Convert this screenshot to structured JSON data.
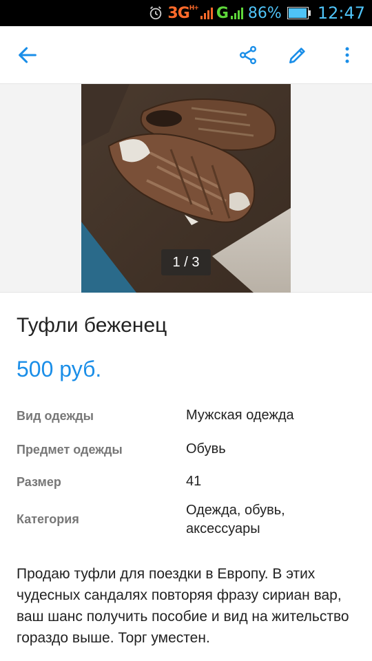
{
  "status_bar": {
    "network": "3G",
    "network_sup": "H+",
    "network2": "G",
    "battery": "86%",
    "time": "12:47",
    "colors": {
      "network": "#ff6a2a",
      "signal": "#5ed63a",
      "battery": "#4fc3f7"
    }
  },
  "app_bar": {
    "icons": [
      "back-arrow-icon",
      "share-icon",
      "edit-pencil-icon",
      "more-vert-icon"
    ],
    "accent": "#1a8ee8"
  },
  "gallery": {
    "counter": "1 / 3",
    "current": 1,
    "total": 3
  },
  "listing": {
    "title": "Туфли беженец",
    "price": "500 руб.",
    "params": [
      {
        "label": "Вид одежды",
        "value": "Мужская одежда"
      },
      {
        "label": "Предмет одежды",
        "value": "Обувь"
      },
      {
        "label": "Размер",
        "value": "41"
      },
      {
        "label": "Категория",
        "value": "Одежда, обувь, аксессуары"
      }
    ],
    "description": "Продаю туфли для поездки в Европу. В этих чудесных сандалях повторяя фразу сириан вар, ваш шанс получить пособие и вид на жительство гораздо выше. Торг уместен."
  }
}
